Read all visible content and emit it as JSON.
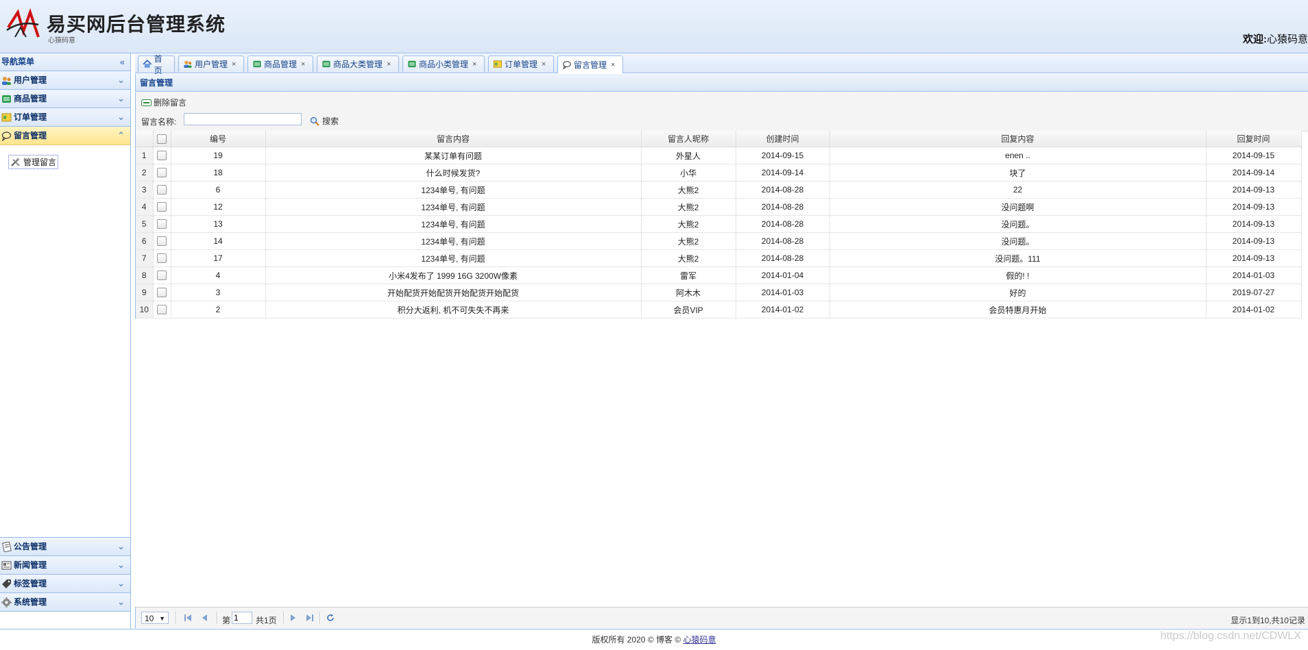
{
  "header": {
    "title": "易买网后台管理系统",
    "subtitle": "心猿码意",
    "welcome_label": "欢迎:",
    "welcome_name": "心猿码意"
  },
  "sidebar": {
    "heading": "导航菜单",
    "collapse_icon": "double-chevron-left-icon",
    "top_items": [
      {
        "label": "用户管理",
        "icon": "users-icon"
      },
      {
        "label": "商品管理",
        "icon": "grid-icon"
      },
      {
        "label": "订单管理",
        "icon": "order-icon"
      },
      {
        "label": "留言管理",
        "icon": "speech-bubble-icon",
        "active": true
      }
    ],
    "sub_item": {
      "label": "管理留言",
      "icon": "tools-icon"
    },
    "bottom_items": [
      {
        "label": "公告管理",
        "icon": "notice-icon"
      },
      {
        "label": "新闻管理",
        "icon": "news-icon"
      },
      {
        "label": "标签管理",
        "icon": "tag-icon"
      },
      {
        "label": "系统管理",
        "icon": "gear-icon"
      }
    ]
  },
  "tabs": [
    {
      "label": "首页",
      "icon": "home-icon",
      "closable": false
    },
    {
      "label": "用户管理",
      "icon": "users-icon",
      "closable": true
    },
    {
      "label": "商品管理",
      "icon": "grid-icon",
      "closable": true
    },
    {
      "label": "商品大类管理",
      "icon": "grid-icon",
      "closable": true
    },
    {
      "label": "商品小类管理",
      "icon": "grid-icon",
      "closable": true
    },
    {
      "label": "订单管理",
      "icon": "order-icon",
      "closable": true
    },
    {
      "label": "留言管理",
      "icon": "speech-bubble-icon",
      "closable": true,
      "active": true
    }
  ],
  "panel": {
    "title": "留言管理",
    "delete_label": "删除留言",
    "search_label": "留言名称:",
    "search_value": "",
    "search_button": "搜索"
  },
  "table": {
    "columns": [
      "编号",
      "留言内容",
      "留言人昵称",
      "创建时间",
      "回复内容",
      "回复时间"
    ],
    "rows": [
      [
        "1",
        "19",
        "某某订单有问题",
        "外星人",
        "2014-09-15",
        "enen ..",
        "2014-09-15"
      ],
      [
        "2",
        "18",
        "什么时候发货?",
        "小华",
        "2014-09-14",
        "块了",
        "2014-09-14"
      ],
      [
        "3",
        "6",
        "1234单号, 有问题",
        "大熊2",
        "2014-08-28",
        "22",
        "2014-09-13"
      ],
      [
        "4",
        "12",
        "1234单号, 有问题",
        "大熊2",
        "2014-08-28",
        "没问题啊",
        "2014-09-13"
      ],
      [
        "5",
        "13",
        "1234单号, 有问题",
        "大熊2",
        "2014-08-28",
        "没问题。",
        "2014-09-13"
      ],
      [
        "6",
        "14",
        "1234单号, 有问题",
        "大熊2",
        "2014-08-28",
        "没问题。",
        "2014-09-13"
      ],
      [
        "7",
        "17",
        "1234单号, 有问题",
        "大熊2",
        "2014-08-28",
        "没问题。111",
        "2014-09-13"
      ],
      [
        "8",
        "4",
        "小米4发布了 1999 16G 3200W像素",
        "雷军",
        "2014-01-04",
        "假的! !",
        "2014-01-03"
      ],
      [
        "9",
        "3",
        "开始配货开始配货开始配货开始配货",
        "阿木木",
        "2014-01-03",
        "好的",
        "2019-07-27"
      ],
      [
        "10",
        "2",
        "积分大返利, 机不可失失不再来",
        "会员VIP",
        "2014-01-02",
        "会员特惠月开始",
        "2014-01-02"
      ]
    ]
  },
  "pager": {
    "page_size": "10",
    "page_prefix": "第",
    "page_value": "1",
    "page_suffix": "共1页",
    "info": "显示1到10,共10记录"
  },
  "footer": {
    "text": "版权所有 2020 © 博客 © ",
    "link": "心猿码意"
  },
  "watermark": "https://blog.csdn.net/CDWLX"
}
